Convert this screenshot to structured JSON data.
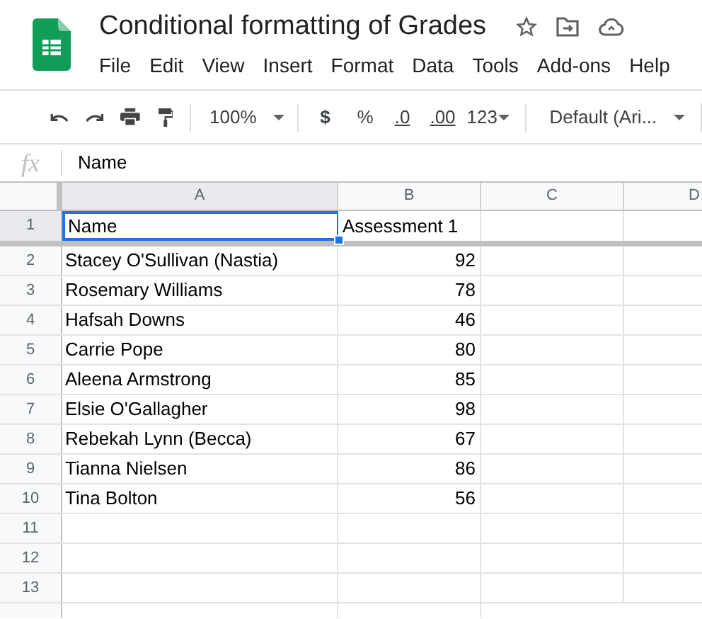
{
  "document": {
    "title": "Conditional formatting of Grades"
  },
  "menu": [
    "File",
    "Edit",
    "View",
    "Insert",
    "Format",
    "Data",
    "Tools",
    "Add-ons",
    "Help"
  ],
  "toolbar": {
    "zoom": "100%",
    "currency": "$",
    "percent": "%",
    "decrease_decimals": ".0",
    "increase_decimals": ".00",
    "number_format": "123",
    "font": "Default (Ari..."
  },
  "formula_bar": {
    "label": "fx",
    "value": "Name"
  },
  "columns": [
    {
      "label": "A",
      "selected": true
    },
    {
      "label": "B",
      "selected": false
    },
    {
      "label": "C",
      "selected": false
    },
    {
      "label": "D",
      "selected": false
    }
  ],
  "rows": [
    {
      "number": "1",
      "name": "Name",
      "score": "Assessment 1",
      "selected": true
    },
    {
      "number": "2",
      "name": "Stacey O'Sullivan (Nastia)",
      "score": "92",
      "selected": false
    },
    {
      "number": "3",
      "name": "Rosemary Williams",
      "score": "78",
      "selected": false
    },
    {
      "number": "4",
      "name": "Hafsah Downs",
      "score": "46",
      "selected": false
    },
    {
      "number": "5",
      "name": "Carrie Pope",
      "score": "80",
      "selected": false
    },
    {
      "number": "6",
      "name": "Aleena Armstrong",
      "score": "85",
      "selected": false
    },
    {
      "number": "7",
      "name": "Elsie O'Gallagher",
      "score": "98",
      "selected": false
    },
    {
      "number": "8",
      "name": "Rebekah Lynn (Becca)",
      "score": "67",
      "selected": false
    },
    {
      "number": "9",
      "name": "Tianna Nielsen",
      "score": "86",
      "selected": false
    },
    {
      "number": "10",
      "name": "Tina Bolton",
      "score": "56",
      "selected": false
    },
    {
      "number": "11",
      "selected": false
    },
    {
      "number": "12",
      "selected": false
    },
    {
      "number": "13",
      "selected": false
    }
  ]
}
